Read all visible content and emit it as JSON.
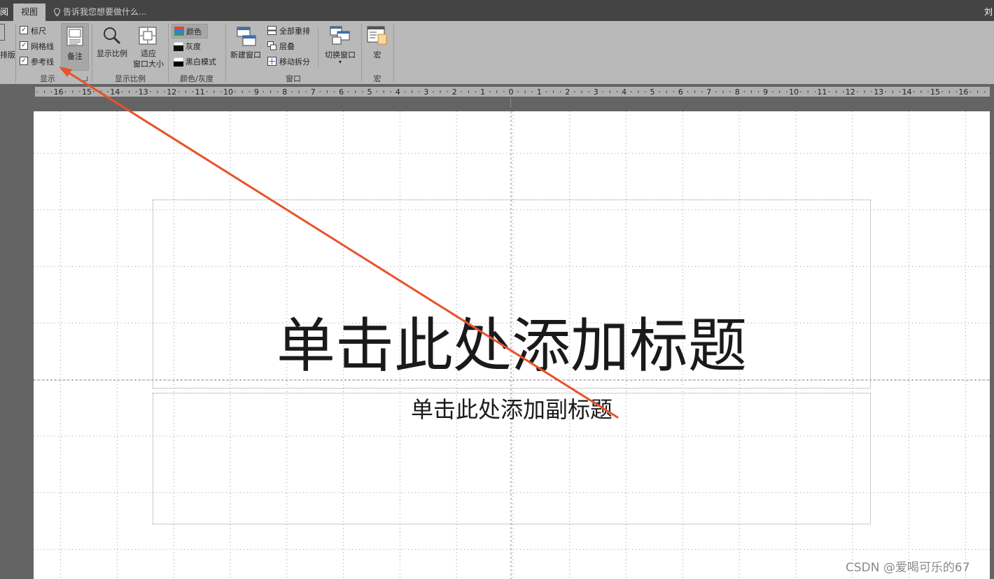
{
  "tabs": {
    "left_partial": "阅",
    "view": "视图",
    "tell_me_placeholder": "告诉我您想要做什么...",
    "user_partial": "刘"
  },
  "ribbon": {
    "partial_left_label": "排版",
    "show": {
      "ruler_label": "标尺",
      "gridlines_label": "网格线",
      "guides_label": "参考线",
      "ruler_checked": true,
      "gridlines_checked": true,
      "guides_checked": true,
      "notes_label": "备注",
      "group_label": "显示"
    },
    "zoom": {
      "zoom_label": "显示比例",
      "fit_label_line1": "适应",
      "fit_label_line2": "窗口大小",
      "group_label": "显示比例"
    },
    "color_gray": {
      "color_label": "颜色",
      "grayscale_label": "灰度",
      "bw_label": "黑白模式",
      "group_label": "颜色/灰度"
    },
    "window": {
      "new_window_label": "新建窗口",
      "arrange_all_label": "全部重排",
      "cascade_label": "层叠",
      "move_split_label": "移动拆分",
      "switch_label": "切换窗口",
      "group_label": "窗口"
    },
    "macros": {
      "macro_label": "宏",
      "group_label": "宏"
    }
  },
  "ruler": {
    "labels": [
      "16",
      "15",
      "14",
      "13",
      "12",
      "11",
      "10",
      "9",
      "8",
      "7",
      "6",
      "5",
      "4",
      "3",
      "2",
      "1",
      "0",
      "1",
      "2",
      "3",
      "4",
      "5",
      "6",
      "7",
      "8",
      "9",
      "10",
      "11",
      "12",
      "13",
      "14",
      "15",
      "16"
    ]
  },
  "slide": {
    "title_placeholder": "单击此处添加标题",
    "subtitle_placeholder": "单击此处添加副标题"
  },
  "watermark": "CSDN @爱喝可乐的67",
  "colors": {
    "annotation_arrow": "#e8522a",
    "ribbon_bg": "#b9b9b9",
    "tabbar_bg": "#444444"
  }
}
